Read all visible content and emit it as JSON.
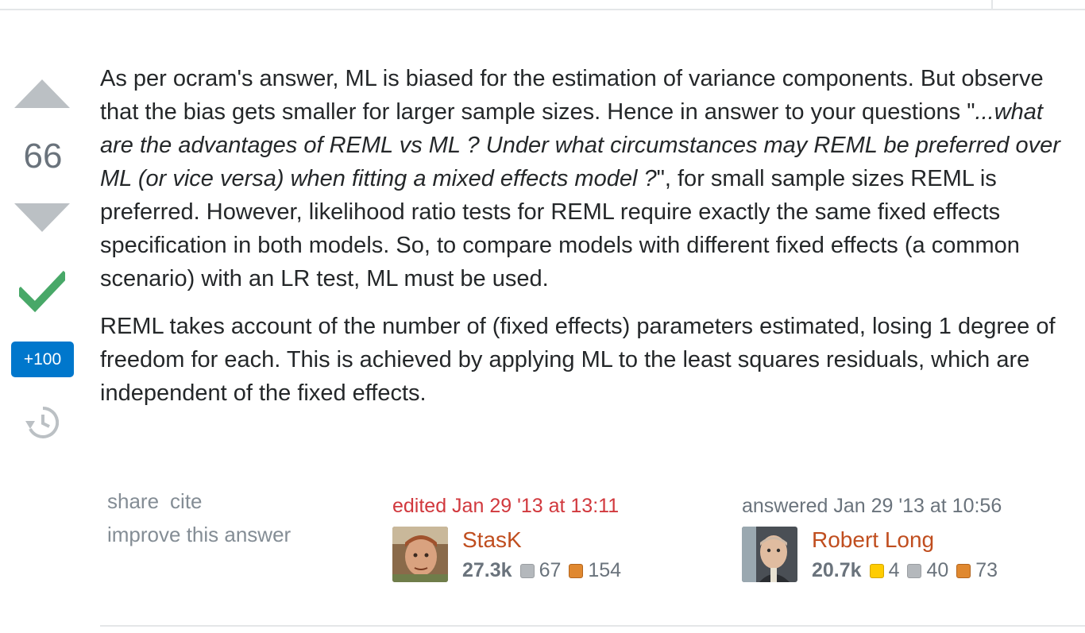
{
  "vote": {
    "count": "66",
    "bounty": "+100",
    "up_label": "vote up",
    "down_label": "vote down",
    "history_icon": "history-icon",
    "accepted_icon": "checkmark-icon"
  },
  "post": {
    "p1_a": "As per ocram's answer, ML is biased for the estimation of variance components. But observe that the bias gets smaller for larger sample sizes. Hence in answer to your questions \"",
    "p1_quote": "...what are the advantages of REML vs ML ? Under what circumstances may REML be preferred over ML (or vice versa) when fitting a mixed effects model ?",
    "p1_b": "\", for small sample sizes REML is preferred. However, likelihood ratio tests for REML require exactly the same fixed effects specification in both models. So, to compare models with different fixed effects (a common scenario) with an LR test, ML must be used.",
    "p2": "REML takes account of the number of (fixed effects) parameters estimated, losing 1 degree of freedom for each. This is achieved by applying ML to the least squares residuals, which are independent of the fixed effects."
  },
  "menu": {
    "share": "share",
    "cite": "cite",
    "improve": "improve this answer"
  },
  "editor": {
    "action": "edited Jan 29 '13 at 13:11",
    "name": "StasK",
    "rep": "27.3k",
    "silver": "67",
    "bronze": "154"
  },
  "author": {
    "action": "answered Jan 29 '13 at 10:56",
    "name": "Robert Long",
    "rep": "20.7k",
    "gold": "4",
    "silver": "40",
    "bronze": "73"
  },
  "colors": {
    "accent": "#0077cc",
    "accepted": "#48a868",
    "username": "#c04e1f",
    "edited": "#d1383d"
  }
}
